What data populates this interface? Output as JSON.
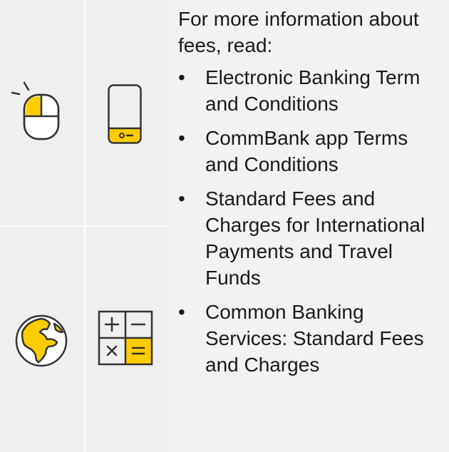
{
  "info": {
    "intro": "For more information about fees, read:",
    "bullet_symbol": "•",
    "links": [
      {
        "label": "Electronic Banking Term and Conditions"
      },
      {
        "label": "CommBank app Terms and Conditions"
      },
      {
        "label": "Standard Fees and Charges for International Payments and Travel Funds"
      },
      {
        "label": "Common Banking Services: Standard Fees and Charges"
      }
    ]
  },
  "icons": {
    "computer": "computer-mouse-icon",
    "mobile": "mobile-phone-icon",
    "international": "globe-icon",
    "calculator": "calculator-icon"
  },
  "colors": {
    "accent": "#ffcc00",
    "stroke": "#333333",
    "tile": "#efefef",
    "divider": "#ffffff"
  }
}
